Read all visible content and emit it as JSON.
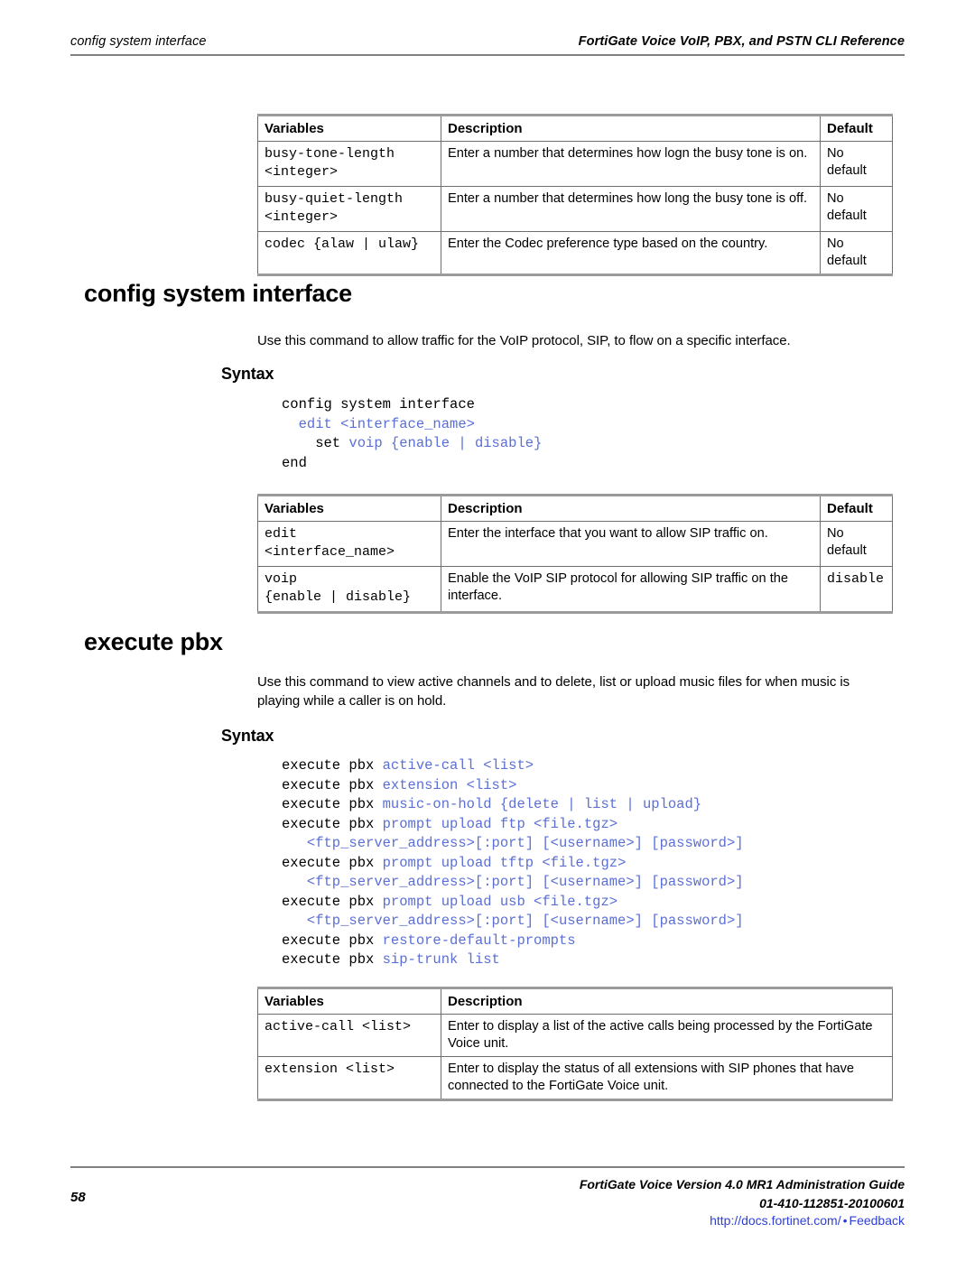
{
  "header": {
    "left": "config system interface",
    "right": "FortiGate Voice VoIP, PBX, and PSTN CLI Reference"
  },
  "colors": {
    "syntax_keyword": "#5b6fd6",
    "link": "#2f3fd8",
    "table_border": "#6e6e6e",
    "rule": "#808080"
  },
  "table_top": {
    "headers": [
      "Variables",
      "Description",
      "Default"
    ],
    "rows": [
      {
        "variable": "busy-tone-length\n<integer>",
        "description": "Enter a number that determines how logn the busy tone is on.",
        "default": "No default"
      },
      {
        "variable": "busy-quiet-length\n<integer>",
        "description": "Enter a number that determines how long the busy tone is off.",
        "default": "No default"
      },
      {
        "variable": "codec {alaw | ulaw}",
        "description": "Enter the Codec preference type based on the country.",
        "default": "No default"
      }
    ]
  },
  "section_interface": {
    "heading": "config system interface",
    "intro": "Use this command to allow traffic for the VoIP protocol, SIP, to flow on a specific interface.",
    "syntax_heading": "Syntax",
    "syntax_lines": [
      [
        {
          "t": "config system interface",
          "c": "plain"
        }
      ],
      [
        {
          "t": "  ",
          "c": "plain"
        },
        {
          "t": "edit <interface_name>",
          "c": "kw"
        }
      ],
      [
        {
          "t": "    set ",
          "c": "plain"
        },
        {
          "t": "voip {enable | disable}",
          "c": "kw"
        }
      ],
      [
        {
          "t": "end",
          "c": "plain"
        }
      ]
    ],
    "table": {
      "headers": [
        "Variables",
        "Description",
        "Default"
      ],
      "rows": [
        {
          "variable": "edit\n<interface_name>",
          "description": "Enter the interface that you want to allow SIP traffic on.",
          "default": "No default",
          "default_mono": false
        },
        {
          "variable": "voip\n{enable | disable}",
          "description": "Enable the VoIP SIP protocol for allowing SIP traffic on the interface.",
          "default": "disable",
          "default_mono": true
        }
      ]
    }
  },
  "section_pbx": {
    "heading": "execute pbx",
    "intro": "Use this command to view active channels and to delete, list or upload music files for when music is playing while a caller is on hold.",
    "syntax_heading": "Syntax",
    "syntax_lines": [
      [
        {
          "t": "execute pbx ",
          "c": "plain"
        },
        {
          "t": "active-call <list>",
          "c": "kw"
        }
      ],
      [
        {
          "t": "execute pbx ",
          "c": "plain"
        },
        {
          "t": "extension <list>",
          "c": "kw"
        }
      ],
      [
        {
          "t": "execute pbx ",
          "c": "plain"
        },
        {
          "t": "music-on-hold {delete | list | upload}",
          "c": "kw"
        }
      ],
      [
        {
          "t": "execute pbx ",
          "c": "plain"
        },
        {
          "t": "prompt upload ftp <file.tgz>",
          "c": "kw"
        }
      ],
      [
        {
          "t": "   ",
          "c": "plain"
        },
        {
          "t": "<ftp_server_address>[:port] [<username>] [password>]",
          "c": "kw"
        }
      ],
      [
        {
          "t": "execute pbx ",
          "c": "plain"
        },
        {
          "t": "prompt upload tftp <file.tgz>",
          "c": "kw"
        }
      ],
      [
        {
          "t": "   ",
          "c": "plain"
        },
        {
          "t": "<ftp_server_address>[:port] [<username>] [password>]",
          "c": "kw"
        }
      ],
      [
        {
          "t": "execute pbx ",
          "c": "plain"
        },
        {
          "t": "prompt upload usb <file.tgz>",
          "c": "kw"
        }
      ],
      [
        {
          "t": "   ",
          "c": "plain"
        },
        {
          "t": "<ftp_server_address>[:port] [<username>] [password>]",
          "c": "kw"
        }
      ],
      [
        {
          "t": "execute pbx ",
          "c": "plain"
        },
        {
          "t": "restore-default-prompts",
          "c": "kw"
        }
      ],
      [
        {
          "t": "execute pbx ",
          "c": "plain"
        },
        {
          "t": "sip-trunk list",
          "c": "kw"
        }
      ]
    ],
    "table": {
      "headers": [
        "Variables",
        "Description"
      ],
      "rows": [
        {
          "variable": "active-call <list>",
          "description": "Enter to display a list of the active calls being processed by the FortiGate Voice unit."
        },
        {
          "variable": "extension <list>",
          "description": "Enter to display the status of all extensions with SIP phones that have connected to the FortiGate Voice unit."
        }
      ]
    }
  },
  "footer": {
    "page_number": "58",
    "line1": "FortiGate Voice Version 4.0 MR1 Administration Guide",
    "line2": "01-410-112851-20100601",
    "link_docs": "http://docs.fortinet.com/",
    "separator": "•",
    "link_feedback": "Feedback"
  }
}
